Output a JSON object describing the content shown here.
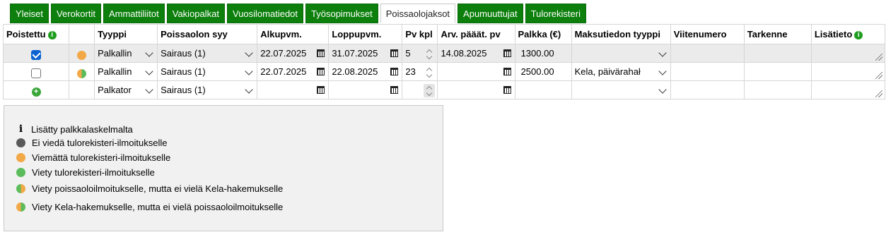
{
  "colors": {
    "tab_green": "#0c7f0c",
    "orange": "#f2a846",
    "green": "#5cbc5c",
    "dark": "#595959",
    "check_blue": "#0a63d1"
  },
  "tabs": [
    "Yleiset",
    "Verokortit",
    "Ammattiliitot",
    "Vakiopalkat",
    "Vuosilomatiedot",
    "Työsopimukset",
    "Poissaolojaksot",
    "Apumuuttujat",
    "Tulorekisteri"
  ],
  "active_tab": "Poissaolojaksot",
  "columns": {
    "poistettu": "Poistettu",
    "tyyppi": "Tyyppi",
    "syy": "Poissaolon syy",
    "alku": "Alkupvm.",
    "loppu": "Loppupvm.",
    "pv": "Pv kpl",
    "arv": "Arv. pääät. pv",
    "palkka": "Palkka (€)",
    "maksu": "Maksutiedon tyyppi",
    "viite": "Viitenumero",
    "tarkenne": "Tarkenne",
    "lisatieto": "Lisätieto"
  },
  "rows": [
    {
      "deleted": true,
      "status": "orange",
      "tyyppi": "Palkallin",
      "syy": "Sairaus (1)",
      "alku": "22.07.2025",
      "loppu": "31.07.2025",
      "pv": "5",
      "arv": "14.08.2025",
      "palkka": "1300.00",
      "maksu": "",
      "viite": "",
      "tarkenne": "",
      "lisatieto": ""
    },
    {
      "deleted": false,
      "status": "half-orange-green",
      "tyyppi": "Palkallin",
      "syy": "Sairaus (1)",
      "alku": "22.07.2025",
      "loppu": "22.08.2025",
      "pv": "23",
      "arv": "",
      "palkka": "2500.00",
      "maksu": "Kela, päivärahał",
      "viite": "",
      "tarkenne": "",
      "lisatieto": ""
    },
    {
      "deleted": null,
      "status": "",
      "tyyppi": "Palkator",
      "syy": "Sairaus (1)",
      "alku": "",
      "loppu": "",
      "pv": "",
      "arv": "",
      "palkka": "",
      "maksu": "",
      "viite": "",
      "tarkenne": "",
      "lisatieto": ""
    }
  ],
  "legend": {
    "added": "Lisätty palkkalaskelmalta",
    "not_exported": "Ei viedä tulorekisteri-ilmoitukselle",
    "pending": "Viemättä tulorekisteri-ilmoitukselle",
    "exported": "Viety tulorekisteri-ilmoitukselle",
    "absence_only": "Viety poissaoloilmoitukselle, mutta ei vielä Kela-hakemukselle",
    "kela_only": "Viety Kela-hakemukselle, mutta ei vielä poissaoloilmoitukselle"
  }
}
